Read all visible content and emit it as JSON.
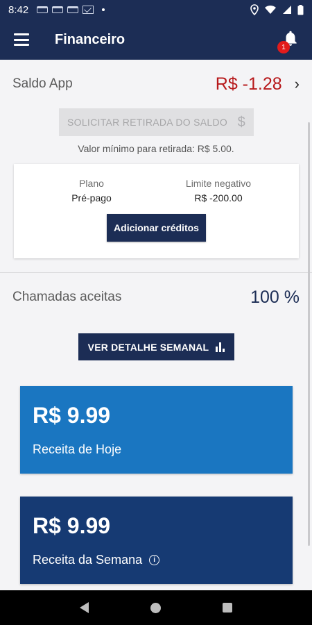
{
  "status_bar": {
    "time": "8:42"
  },
  "app_bar": {
    "title": "Financeiro",
    "notification_count": "1"
  },
  "saldo": {
    "label": "Saldo App",
    "value": "R$ -1.28",
    "chevron": "›"
  },
  "withdraw": {
    "button_label": "SOLICITAR RETIRADA DO SALDO",
    "currency_icon": "$",
    "min_text": "Valor mínimo para retirada: R$ 5.00."
  },
  "plan": {
    "plan_label": "Plano",
    "plan_value": "Pré-pago",
    "limit_label": "Limite negativo",
    "limit_value": "R$ -200.00",
    "add_credits_label": "Adicionar créditos"
  },
  "calls": {
    "label": "Chamadas aceitas",
    "value": "100 %"
  },
  "weekly_button": {
    "label": "VER DETALHE SEMANAL"
  },
  "cards": {
    "today": {
      "amount": "R$ 9.99",
      "label": "Receita de Hoje",
      "color": "#1a76c1"
    },
    "week": {
      "amount": "R$ 9.99",
      "label": "Receita da Semana",
      "color": "#163a73",
      "info_icon": "i"
    }
  },
  "colors": {
    "primary": "#1c2d55",
    "negative": "#b7191b",
    "badge": "#e21b1b"
  }
}
